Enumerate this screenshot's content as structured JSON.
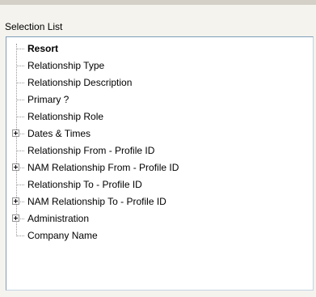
{
  "section_label": "Selection List",
  "tree": {
    "items": [
      {
        "label": "Resort",
        "bold": true,
        "expandable": false
      },
      {
        "label": "Relationship Type",
        "bold": false,
        "expandable": false
      },
      {
        "label": "Relationship Description",
        "bold": false,
        "expandable": false
      },
      {
        "label": "Primary ?",
        "bold": false,
        "expandable": false
      },
      {
        "label": "Relationship Role",
        "bold": false,
        "expandable": false
      },
      {
        "label": "Dates & Times",
        "bold": false,
        "expandable": true
      },
      {
        "label": "Relationship From - Profile ID",
        "bold": false,
        "expandable": false
      },
      {
        "label": "NAM  Relationship From - Profile ID",
        "bold": false,
        "expandable": true
      },
      {
        "label": "Relationship To - Profile ID",
        "bold": false,
        "expandable": false
      },
      {
        "label": "NAM  Relationship To - Profile ID",
        "bold": false,
        "expandable": true
      },
      {
        "label": "Administration",
        "bold": false,
        "expandable": true
      },
      {
        "label": "Company Name",
        "bold": false,
        "expandable": false
      }
    ]
  }
}
